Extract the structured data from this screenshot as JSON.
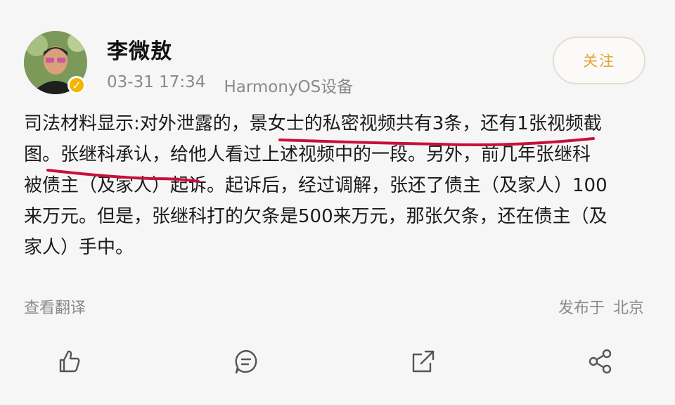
{
  "header": {
    "username": "李微敖",
    "date": "03-31 17:34",
    "device": "HarmonyOS设备",
    "follow_label": "关注"
  },
  "post": {
    "lines": [
      "司法材料显示:对外泄露的，景女士的私密视频共有3条，还有1张视频截",
      "图。张继科承认，给他人看过上述视频中的一段。另外，前几年张继科",
      "被债主（及家人）起诉。起诉后，经过调解，张还了债主（及家人）100",
      "来万元。但是，张继科打的欠条是500来万元，那张欠条，还在债主（及",
      "家人）手中。"
    ],
    "translate_label": "查看翻译",
    "published_label": "发布于",
    "location": "北京"
  },
  "highlight_color": "#c8103a",
  "accent_color": "#e5a33a",
  "actions": [
    {
      "name": "like-icon"
    },
    {
      "name": "comment-icon"
    },
    {
      "name": "repost-icon"
    },
    {
      "name": "share-icon"
    }
  ]
}
